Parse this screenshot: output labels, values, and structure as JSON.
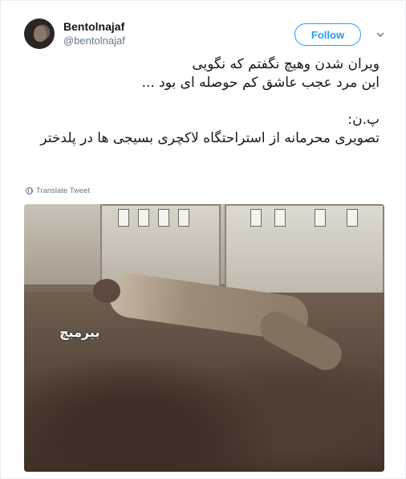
{
  "header": {
    "display_name": "Bentolnajaf",
    "handle": "@bentolnajaf",
    "follow_label": "Follow"
  },
  "tweet": {
    "lines": [
      "ویران شدن وهیچ نگفتم که نگویی",
      "این مرد عجب عاشق کم حوصله ای بود ..."
    ],
    "ps_label": "پ.ن:",
    "ps_text": "تصویری محرمانه از استراحتگاه لاکچری بسیجی ها در پلدختر",
    "translate_label": "Translate Tweet"
  },
  "media": {
    "watermark": "بیرمبچ"
  },
  "colors": {
    "accent": "#1da1f2",
    "text": "#14171a",
    "muted": "#657786"
  },
  "icons": {
    "more": "chevron-down-icon",
    "translate": "globe-icon"
  }
}
